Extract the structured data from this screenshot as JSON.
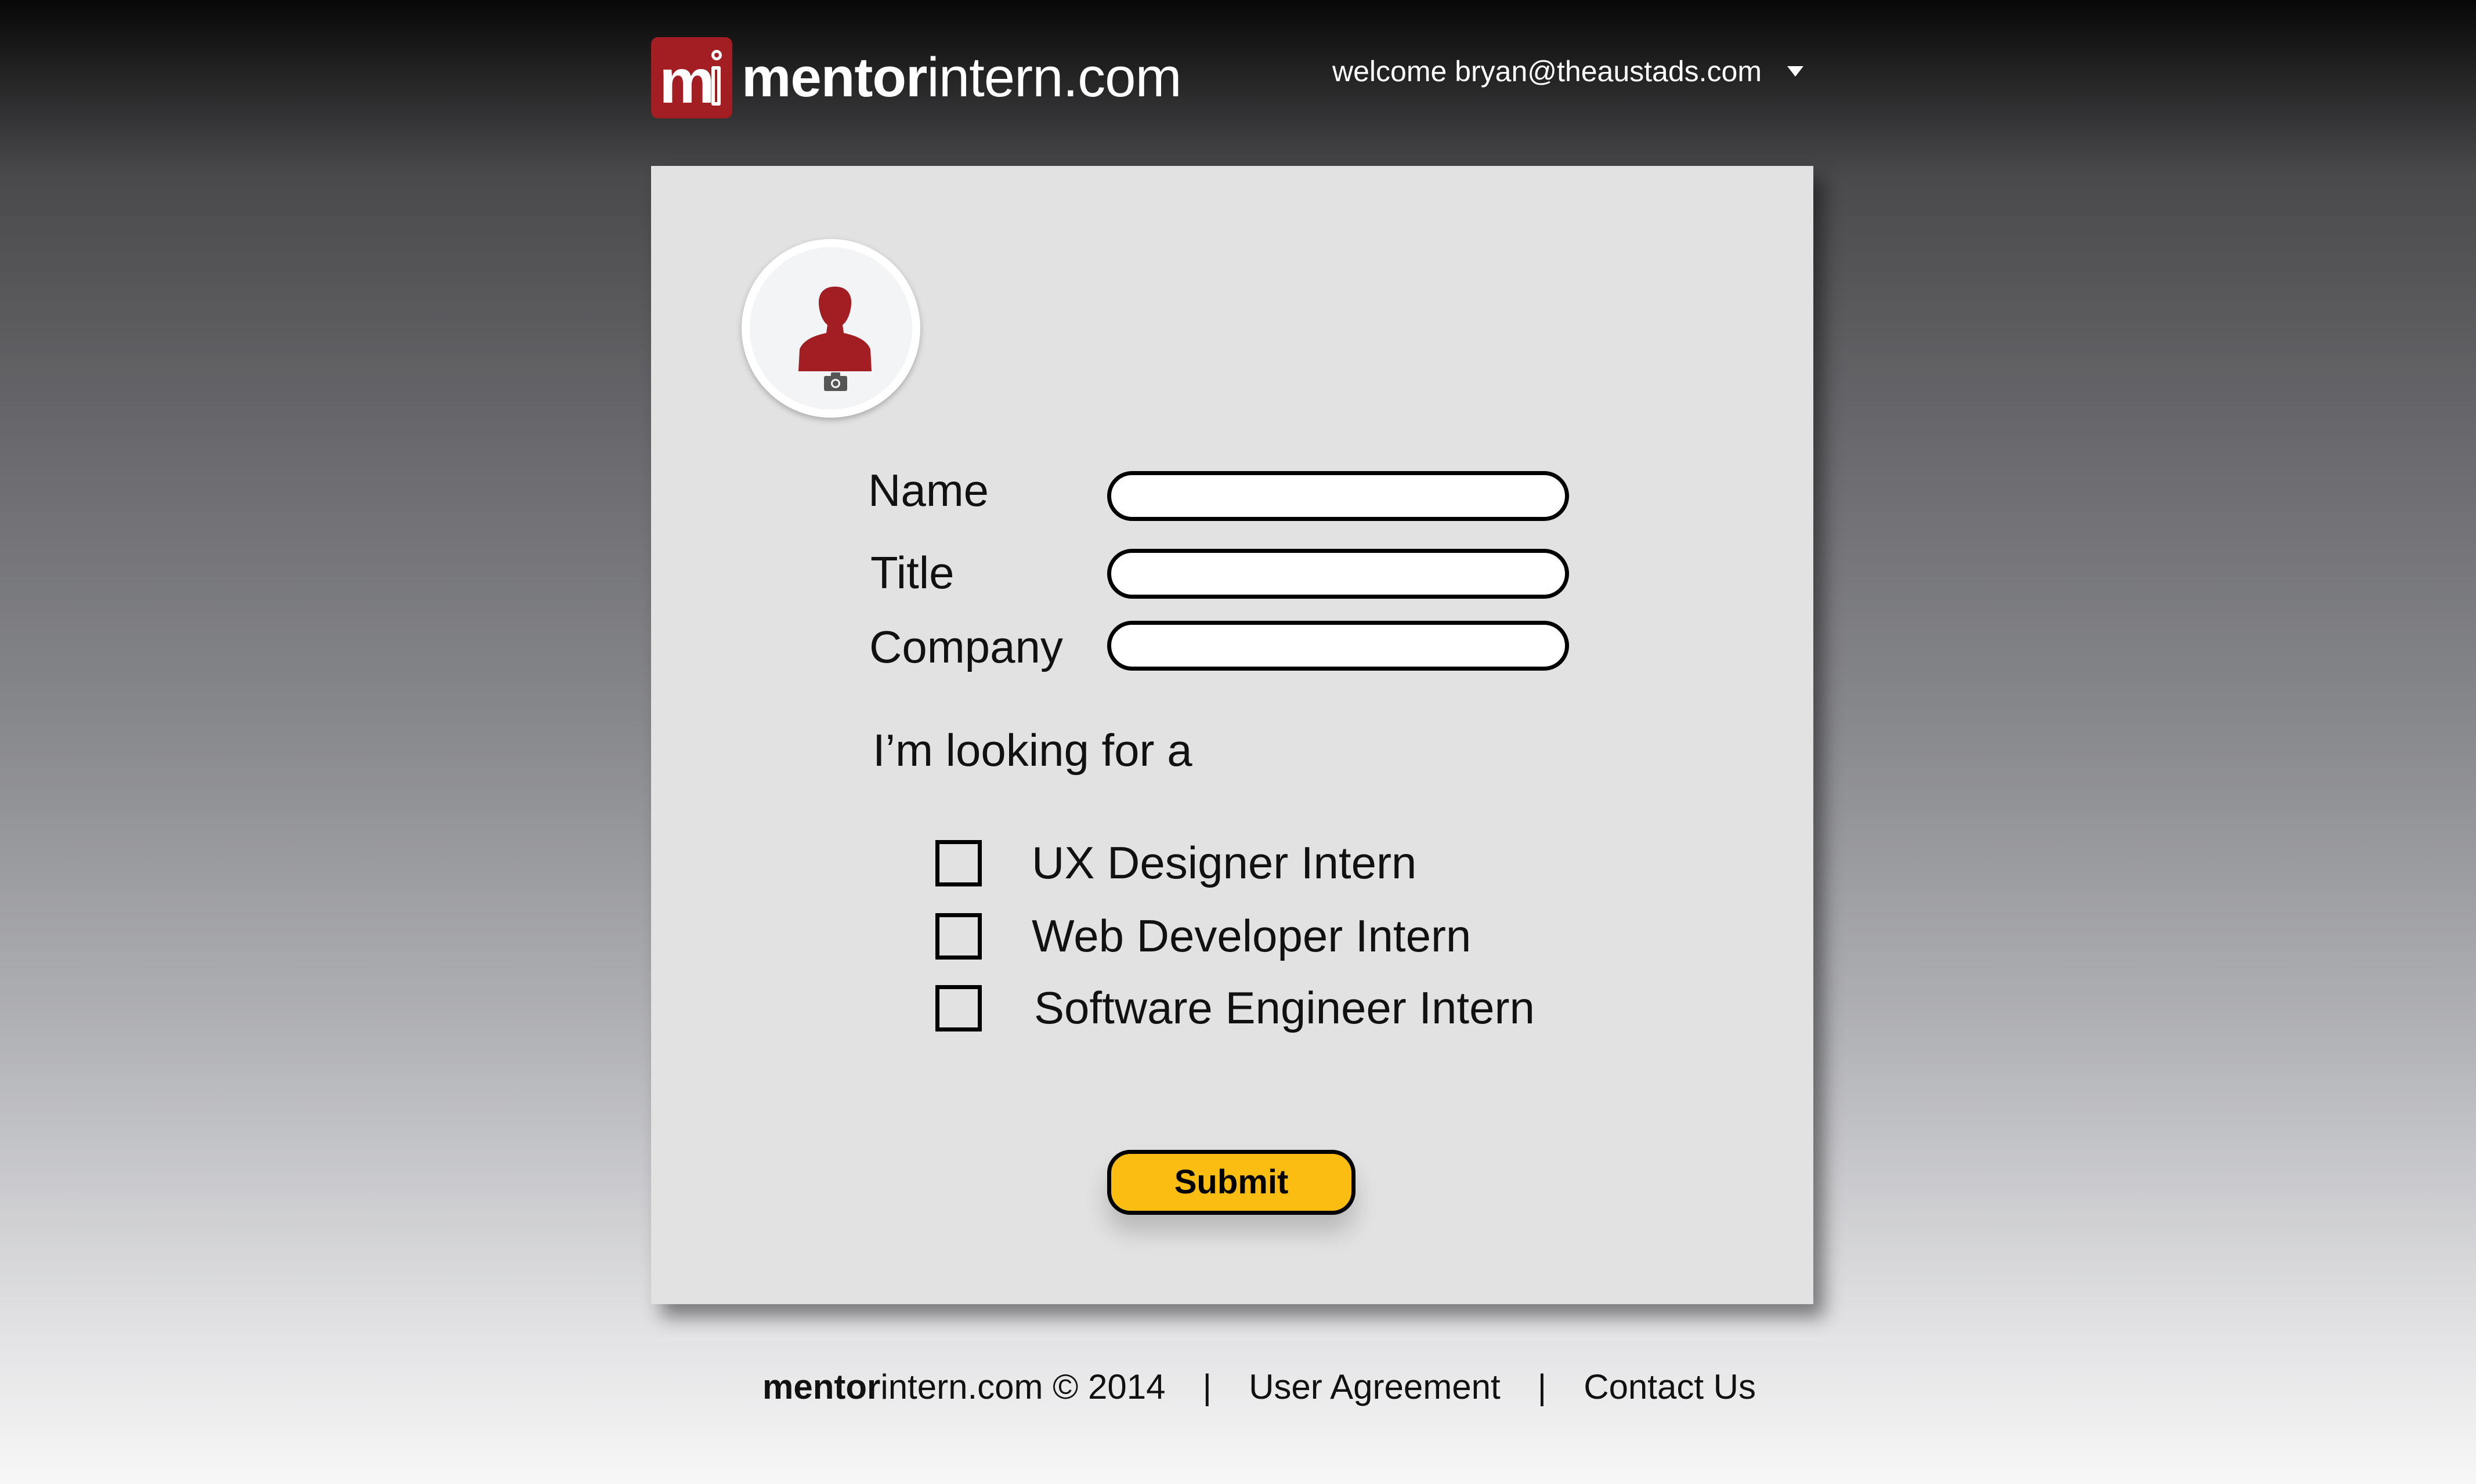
{
  "header": {
    "logo_mark": "mi",
    "brand_bold": "mentor",
    "brand_regular": "intern.com",
    "welcome_text": "welcome bryan@theaustads.com",
    "menu_icon": "caret-down-icon"
  },
  "profile": {
    "avatar_icon": "person-icon",
    "camera_icon": "camera-icon",
    "fields": [
      {
        "label": "Name",
        "value": ""
      },
      {
        "label": "Title",
        "value": ""
      },
      {
        "label": "Company",
        "value": ""
      }
    ],
    "looking_for_label": "I’m looking for a",
    "options": [
      {
        "label": "UX Designer Intern",
        "checked": false
      },
      {
        "label": "Web Developer Intern",
        "checked": false
      },
      {
        "label": "Software Engineer Intern",
        "checked": false
      }
    ],
    "submit_label": "Submit"
  },
  "footer": {
    "brand_bold": "mentor",
    "brand_regular": "intern.com © 2014",
    "separator": "|",
    "user_agreement": "User Agreement",
    "contact_us": "Contact Us"
  },
  "colors": {
    "brand_red": "#a31e22",
    "submit_yellow": "#fbbd12",
    "card_bg": "#e1e2e1"
  }
}
